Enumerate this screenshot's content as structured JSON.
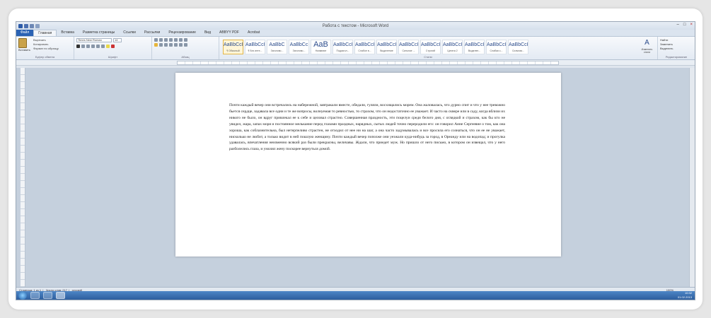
{
  "window": {
    "title": "Работа с текстом - Microsoft Word",
    "controls": {
      "minimize": "–",
      "maximize": "□",
      "close": "×"
    }
  },
  "ribbon_tabs": [
    "Файл",
    "Главная",
    "Вставка",
    "Разметка страницы",
    "Ссылки",
    "Рассылки",
    "Рецензирование",
    "Вид",
    "ABBYY PDF",
    "Acrobat"
  ],
  "clipboard": {
    "paste_label": "Вставить",
    "cut": "Вырезать",
    "copy": "Копировать",
    "format_painter": "Формат по образцу",
    "group_label": "Буфер обмена"
  },
  "font": {
    "name": "Times New Roman",
    "size": "14",
    "group_label": "Шрифт"
  },
  "paragraph": {
    "group_label": "Абзац"
  },
  "styles": {
    "group_label": "Стили",
    "items": [
      {
        "sample": "AaBbCcI",
        "name": "¶ Обычный",
        "selected": true
      },
      {
        "sample": "AaBbCcI",
        "name": "¶ Без инте...",
        "selected": false
      },
      {
        "sample": "AaBbC",
        "name": "Заголово...",
        "selected": false
      },
      {
        "sample": "AaBbCc",
        "name": "Заголово...",
        "selected": false
      },
      {
        "sample": "AaB",
        "name": "Название",
        "selected": false
      },
      {
        "sample": "AaBbCcI",
        "name": "Подзагол...",
        "selected": false
      },
      {
        "sample": "AaBbCcI",
        "name": "Слабое в...",
        "selected": false
      },
      {
        "sample": "AaBbCcI",
        "name": "Выделение",
        "selected": false
      },
      {
        "sample": "AaBbCcI",
        "name": "Сильное ...",
        "selected": false
      },
      {
        "sample": "AaBbCcI",
        "name": "Строгий",
        "selected": false
      },
      {
        "sample": "AaBbCcI",
        "name": "Цитата 2",
        "selected": false
      },
      {
        "sample": "AaBbCcI",
        "name": "Выделен...",
        "selected": false
      },
      {
        "sample": "AaBbCcI",
        "name": "Слабая с...",
        "selected": false
      },
      {
        "sample": "AaBbCcI",
        "name": "Сильная...",
        "selected": false
      }
    ],
    "change_styles": "Изменить стили"
  },
  "editing": {
    "find": "Найти",
    "replace": "Заменить",
    "select": "Выделить",
    "group_label": "Редактирование"
  },
  "document": {
    "paragraph": "Почти каждый вечер они встречались на набережной, завтракали вместе, обедали, гуляли, восхищались морем. Она жаловалась, что дурно спит и что у нее тревожно бьется сердце, задавала все одни и те же вопросы, волнуемая то ревностью, то страхом, что он недостаточно ее уважает. И часто на сквере или в саду, когда вблизи их никого не было, он вдруг привлекал ее к себе и целовал страстно. Совершенная праздность, эти поцелуи среди белого дня, с оглядкой и страхом, как бы кто не увидел, жара, запах моря и постоянное мелькание перед глазами праздных, нарядных, сытых людей точно переродили его: он говорил Анне Сергеевне о том, как она хороша, как соблазнительна, был нетерпеливо страстен, не отходил от нее ни на шаг, а она часто задумывалась и все просила его сознаться, что он ее не уважает, нисколько не любит, а только видит в ней пошлую женщину. Почти каждый вечер попозже они уезжали куда-нибудь за город, в Ореанду или на водопад; и прогулка удавалась, впечатления неизменно всякий раз были прекрасны, величавы. Ждали, что приедет муж. Но пришло от него письмо, в котором он извещал, что у него разболелись глаза, и умолял жену поскорее вернуться домой."
  },
  "status": {
    "page": "Страница: 1 из 1",
    "words": "Число слов: 217",
    "language": "русский",
    "zoom": "100%"
  },
  "taskbar": {
    "time": "10:32",
    "date": "01.02.2013"
  }
}
